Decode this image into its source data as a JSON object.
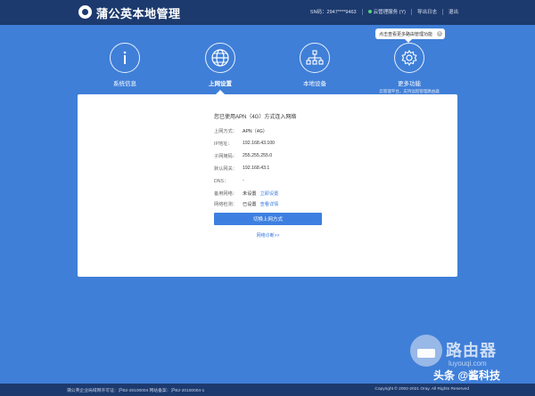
{
  "header": {
    "brand": "蒲公英本地管理",
    "sn": "SN码：2947****9463",
    "cloud_status": "云管理服务 (Y)",
    "log_label": "导出日志",
    "logout_label": "退出"
  },
  "tooltip": {
    "text": "点击查看更多路由管理功能",
    "close": "×"
  },
  "nav": {
    "items": [
      {
        "label": "系统信息",
        "icon": "info-icon"
      },
      {
        "label": "上网设置",
        "icon": "globe-icon"
      },
      {
        "label": "本地设备",
        "icon": "network-icon"
      },
      {
        "label": "更多功能",
        "icon": "gear-icon"
      }
    ],
    "more_sub": "云管理平台，支持远程管理路由器"
  },
  "panel": {
    "title": "您已使用APN（4G）方式连入网络",
    "rows": [
      {
        "key": "上网方式：",
        "value": "APN（4G）"
      },
      {
        "key": "IP地址：",
        "value": "192.168.43.100"
      },
      {
        "key": "子网掩码：",
        "value": "255.255.255.0"
      },
      {
        "key": "默认网关：",
        "value": "192.168.43.1"
      },
      {
        "key": "DNS：",
        "value": "-"
      },
      {
        "key": "备用网络：",
        "value": "未设置",
        "link": "立即设置"
      },
      {
        "key": "网络检测：",
        "value": "已设置",
        "link": "查看详情"
      }
    ],
    "button": "切换上网方式",
    "diag_link": "网络诊断>>"
  },
  "watermark": {
    "text": "路由器",
    "url": "luyouqi.com",
    "toutiao": "头条 @酱科技"
  },
  "footer": {
    "left": "蒲公英企业局域网许可证：沪B2-20100004 网站备案：沪B2-20100004-1",
    "right": "Copyright © 2002-2021 Oray. All Rights Reserved"
  },
  "colors": {
    "header_bg": "#1d3a6e",
    "page_bg": "#3f7fd8",
    "accent": "#3d7fe0",
    "status_online": "#4fd47a"
  }
}
